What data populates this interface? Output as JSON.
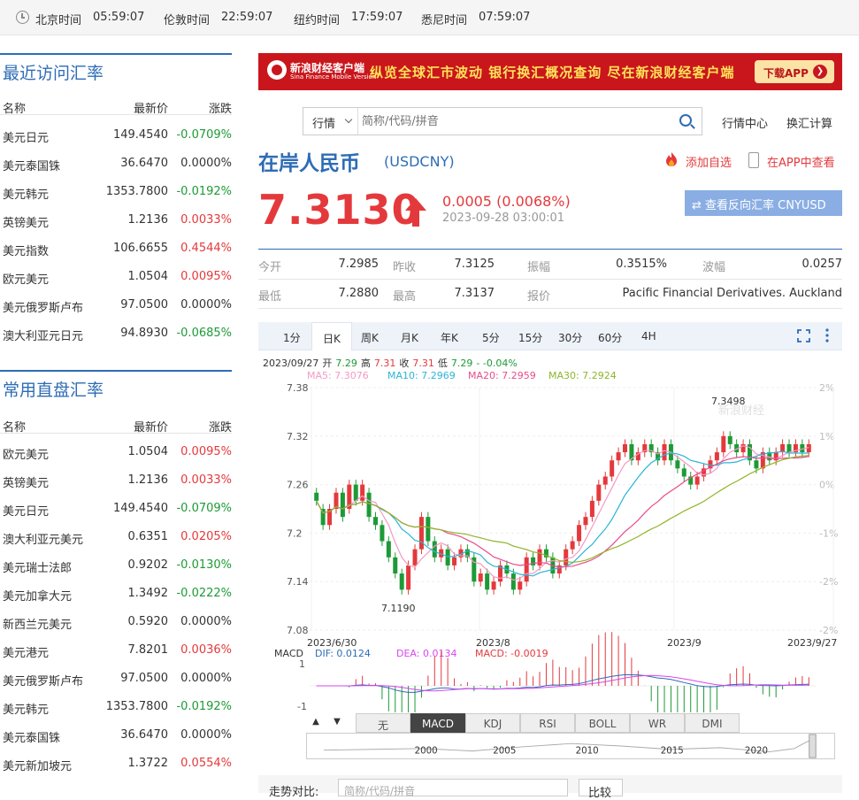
{
  "clocks": [
    {
      "city": "北京时间",
      "time": "05:59:07"
    },
    {
      "city": "伦敦时间",
      "time": "22:59:07"
    },
    {
      "city": "纽约时间",
      "time": "17:59:07"
    },
    {
      "city": "悉尼时间",
      "time": "07:59:07"
    }
  ],
  "recent": {
    "title": "最近访问汇率",
    "cols": [
      "名称",
      "最新价",
      "涨跌"
    ],
    "rows": [
      {
        "name": "美元日元",
        "price": "149.4540",
        "chg": "-0.0709%"
      },
      {
        "name": "美元泰国铢",
        "price": "36.6470",
        "chg": "0.0000%"
      },
      {
        "name": "美元韩元",
        "price": "1353.7800",
        "chg": "-0.0192%"
      },
      {
        "name": "英镑美元",
        "price": "1.2136",
        "chg": "0.0033%"
      },
      {
        "name": "美元指数",
        "price": "106.6655",
        "chg": "0.4544%"
      },
      {
        "name": "欧元美元",
        "price": "1.0504",
        "chg": "0.0095%"
      },
      {
        "name": "美元俄罗斯卢布",
        "price": "97.0500",
        "chg": "0.0000%"
      },
      {
        "name": "澳大利亚元日元",
        "price": "94.8930",
        "chg": "-0.0685%"
      }
    ]
  },
  "common": {
    "title": "常用直盘汇率",
    "cols": [
      "名称",
      "最新价",
      "涨跌"
    ],
    "rows": [
      {
        "name": "欧元美元",
        "price": "1.0504",
        "chg": "0.0095%"
      },
      {
        "name": "英镑美元",
        "price": "1.2136",
        "chg": "0.0033%"
      },
      {
        "name": "美元日元",
        "price": "149.4540",
        "chg": "-0.0709%"
      },
      {
        "name": "澳大利亚元美元",
        "price": "0.6351",
        "chg": "0.0205%"
      },
      {
        "name": "美元瑞士法郎",
        "price": "0.9202",
        "chg": "-0.0130%"
      },
      {
        "name": "美元加拿大元",
        "price": "1.3492",
        "chg": "-0.0222%"
      },
      {
        "name": "新西兰元美元",
        "price": "0.5920",
        "chg": "0.0000%"
      },
      {
        "name": "美元港元",
        "price": "7.8201",
        "chg": "0.0036%"
      },
      {
        "name": "美元俄罗斯卢布",
        "price": "97.0500",
        "chg": "0.0000%"
      },
      {
        "name": "美元韩元",
        "price": "1353.7800",
        "chg": "-0.0192%"
      },
      {
        "name": "美元泰国铢",
        "price": "36.6470",
        "chg": "0.0000%"
      },
      {
        "name": "美元新加坡元",
        "price": "1.3722",
        "chg": "0.0554%"
      }
    ]
  },
  "banner": {
    "brand": "新浪财经客户端",
    "brand_en": "Sina Finance Mobile Version",
    "slogan": "纵览全球汇市波动  银行换汇概况查询  尽在新浪财经客户端",
    "download": "下载APP"
  },
  "search": {
    "type": "行情",
    "placeholder": "简称/代码/拼音"
  },
  "links": {
    "market_center": "行情中心",
    "calc": "换汇计算"
  },
  "quote": {
    "name": "在岸人民币",
    "code": "(USDCNY)",
    "add_fav": "添加自选",
    "in_app": "在APP中查看",
    "price": "7.3130",
    "change": "0.0005 (0.0068%)",
    "time": "2023-09-28 03:00:01",
    "reverse": "⇄ 查看反向汇率 CNYUSD"
  },
  "stats": {
    "open_l": "今开",
    "open": "7.2985",
    "prev_l": "昨收",
    "prev": "7.3125",
    "amp_l": "振幅",
    "amp": "0.3515%",
    "wave_l": "波幅",
    "wave": "0.0257",
    "low_l": "最低",
    "low": "7.2880",
    "high_l": "最高",
    "high": "7.3137",
    "quote_l": "报价",
    "quote_src": "Pacific Financial Derivatives. Auckland"
  },
  "tabs": [
    "1分",
    "日K",
    "周K",
    "月K",
    "年K",
    "5分",
    "15分",
    "30分",
    "60分",
    "4H"
  ],
  "ohlc": {
    "date": "2023/09/27",
    "open_l": "开",
    "open": "7.29",
    "high_l": "高",
    "high": "7.31",
    "close_l": "收",
    "close": "7.31",
    "low_l": "低",
    "low": "7.29",
    "chg": "- -0.04%"
  },
  "ma": [
    {
      "label": "MA5: 7.3076",
      "color": "#f39ac4"
    },
    {
      "label": "MA10: 7.2969",
      "color": "#2bb5d6"
    },
    {
      "label": "MA20: 7.2959",
      "color": "#e84c8b"
    },
    {
      "label": "MA30: 7.2924",
      "color": "#8fb52a"
    }
  ],
  "macd": {
    "label": "MACD",
    "dif": "DIF: 0.0124",
    "dea": "DEA: 0.0134",
    "macd": "MACD: -0.0019"
  },
  "bottom_tabs": [
    "无",
    "MACD",
    "KDJ",
    "RSI",
    "BOLL",
    "WR",
    "DMI"
  ],
  "compare": {
    "label": "走势对比:",
    "placeholder": "简称/代码/拼音",
    "button": "比较"
  },
  "chart_data": {
    "type": "candlestick",
    "title": "",
    "y_ticks": [
      "7.38",
      "7.32",
      "7.26",
      "7.2",
      "7.14",
      "7.08"
    ],
    "pct_ticks": [
      "2%",
      "1%",
      "0%",
      "-1%",
      "-2%",
      "-2%"
    ],
    "x_ticks": [
      "2023/6/30",
      "2023/8",
      "2023/9",
      "2023/9/27"
    ],
    "ylim": [
      7.08,
      7.38
    ],
    "annotations": [
      "7.3498",
      "7.1190"
    ],
    "watermark": "新浪财经",
    "macd_ticks": [
      "1",
      "-1"
    ],
    "nav_ticks": [
      "2000",
      "2005",
      "2010",
      "2015",
      "2020"
    ],
    "closes": [
      7.24,
      7.21,
      7.23,
      7.25,
      7.22,
      7.26,
      7.24,
      7.26,
      7.22,
      7.21,
      7.19,
      7.17,
      7.15,
      7.13,
      7.16,
      7.18,
      7.22,
      7.19,
      7.17,
      7.18,
      7.16,
      7.17,
      7.18,
      7.17,
      7.14,
      7.15,
      7.13,
      7.14,
      7.16,
      7.15,
      7.13,
      7.14,
      7.17,
      7.16,
      7.18,
      7.17,
      7.15,
      7.16,
      7.18,
      7.19,
      7.21,
      7.22,
      7.24,
      7.26,
      7.27,
      7.29,
      7.3,
      7.31,
      7.29,
      7.3,
      7.31,
      7.3,
      7.29,
      7.31,
      7.29,
      7.28,
      7.27,
      7.26,
      7.27,
      7.28,
      7.29,
      7.3,
      7.32,
      7.31,
      7.3,
      7.31,
      7.29,
      7.28,
      7.3,
      7.29,
      7.3,
      7.31,
      7.3,
      7.31,
      7.3,
      7.31
    ],
    "opens": [
      7.25,
      7.23,
      7.21,
      7.23,
      7.25,
      7.23,
      7.26,
      7.24,
      7.25,
      7.22,
      7.21,
      7.19,
      7.17,
      7.15,
      7.13,
      7.16,
      7.18,
      7.22,
      7.19,
      7.17,
      7.18,
      7.16,
      7.17,
      7.18,
      7.17,
      7.14,
      7.15,
      7.13,
      7.14,
      7.16,
      7.15,
      7.13,
      7.14,
      7.17,
      7.16,
      7.18,
      7.17,
      7.15,
      7.16,
      7.18,
      7.19,
      7.21,
      7.22,
      7.24,
      7.26,
      7.27,
      7.29,
      7.3,
      7.31,
      7.29,
      7.3,
      7.31,
      7.3,
      7.29,
      7.31,
      7.29,
      7.28,
      7.27,
      7.26,
      7.27,
      7.28,
      7.29,
      7.3,
      7.32,
      7.31,
      7.3,
      7.31,
      7.29,
      7.28,
      7.3,
      7.29,
      7.3,
      7.31,
      7.3,
      7.31,
      7.3
    ]
  }
}
